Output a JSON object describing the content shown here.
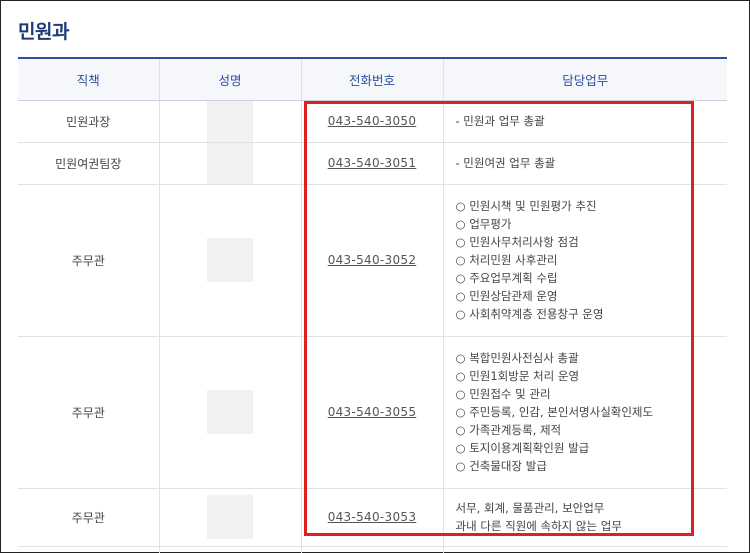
{
  "section_title": "민원과",
  "headers": {
    "position": "직책",
    "name": "성명",
    "phone": "전화번호",
    "duty": "담당업무"
  },
  "rows": [
    {
      "position": "민원과장",
      "phone": "043-540-3050",
      "duties": [
        "- 민원과 업무 총괄"
      ]
    },
    {
      "position": "민원여권팀장",
      "phone": "043-540-3051",
      "duties": [
        "- 민원여권 업무 총괄"
      ]
    },
    {
      "position": "주무관",
      "phone": "043-540-3052",
      "duties": [
        "○ 민원시책 및 민원평가 추진",
        "○ 업무평가",
        "○ 민원사무처리사항 점검",
        "○ 처리민원 사후관리",
        "○ 주요업무계획 수립",
        "○ 민원상담관제 운영",
        "○ 사회취약계층 전용창구 운영"
      ]
    },
    {
      "position": "주무관",
      "phone": "043-540-3055",
      "duties": [
        "○ 복합민원사전심사 총괄",
        "○ 민원1회방문 처리 운영",
        "○ 민원접수 및 관리",
        "○ 주민등록, 인감, 본인서명사실확인제도",
        "○ 가족관계등록, 제적",
        "○ 토지이용계획확인원 발급",
        "○ 건축물대장 발급"
      ]
    },
    {
      "position": "주무관",
      "phone": "043-540-3053",
      "duties": [
        "서무, 회계, 물품관리, 보안업무",
        "과내 다른 직원에 속하지 않는 업무"
      ]
    }
  ]
}
